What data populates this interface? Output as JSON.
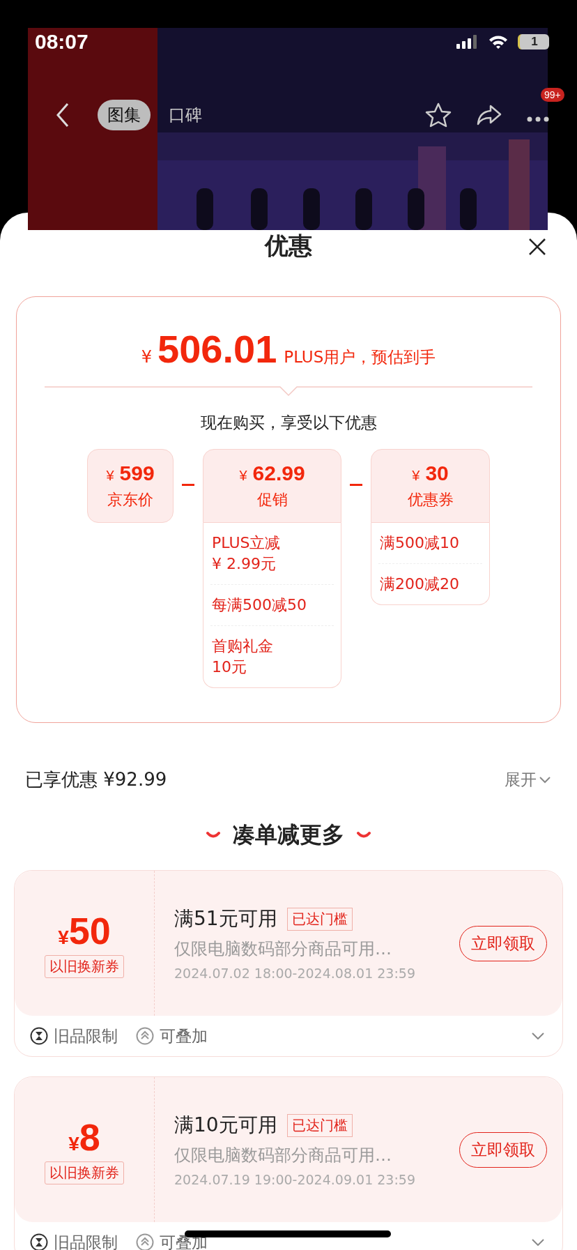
{
  "status_bar": {
    "time": "08:07",
    "battery": "1"
  },
  "nav": {
    "tabs": [
      {
        "label": "图集",
        "selected": true
      },
      {
        "label": "口碑",
        "selected": false
      }
    ],
    "badge": "99+"
  },
  "sheet": {
    "title": "优惠"
  },
  "price_card": {
    "currency": "¥",
    "price": "506.01",
    "note": "PLUS用户，预估到手",
    "subtitle": "现在购买，享受以下优惠",
    "columns": [
      {
        "currency": "¥",
        "amount": "599",
        "label": "京东价"
      },
      {
        "currency": "¥",
        "amount": "62.99",
        "label": "促销",
        "details": [
          "PLUS立减\n¥ 2.99元",
          "每满500减50",
          "首购礼金\n10元"
        ]
      },
      {
        "currency": "¥",
        "amount": "30",
        "label": "优惠券",
        "details": [
          "满500减10",
          "满200减20"
        ]
      }
    ]
  },
  "savings": {
    "label": "已享优惠 ¥92.99",
    "expand": "展开"
  },
  "section_title": "凑单减更多",
  "coupons": [
    {
      "currency": "¥",
      "amount": "50",
      "type": "以旧换新券",
      "condition": "满51元可用",
      "tag": "已达门槛",
      "desc": "仅限电脑数码部分商品可用…",
      "period": "2024.07.02 18:00-2024.08.01 23:59",
      "button": "立即领取",
      "features": [
        "旧品限制",
        "可叠加"
      ]
    },
    {
      "currency": "¥",
      "amount": "8",
      "type": "以旧换新券",
      "condition": "满10元可用",
      "tag": "已达门槛",
      "desc": "仅限电脑数码部分商品可用…",
      "period": "2024.07.19 19:00-2024.09.01 23:59",
      "button": "立即领取",
      "features": [
        "旧品限制",
        "可叠加"
      ]
    }
  ]
}
